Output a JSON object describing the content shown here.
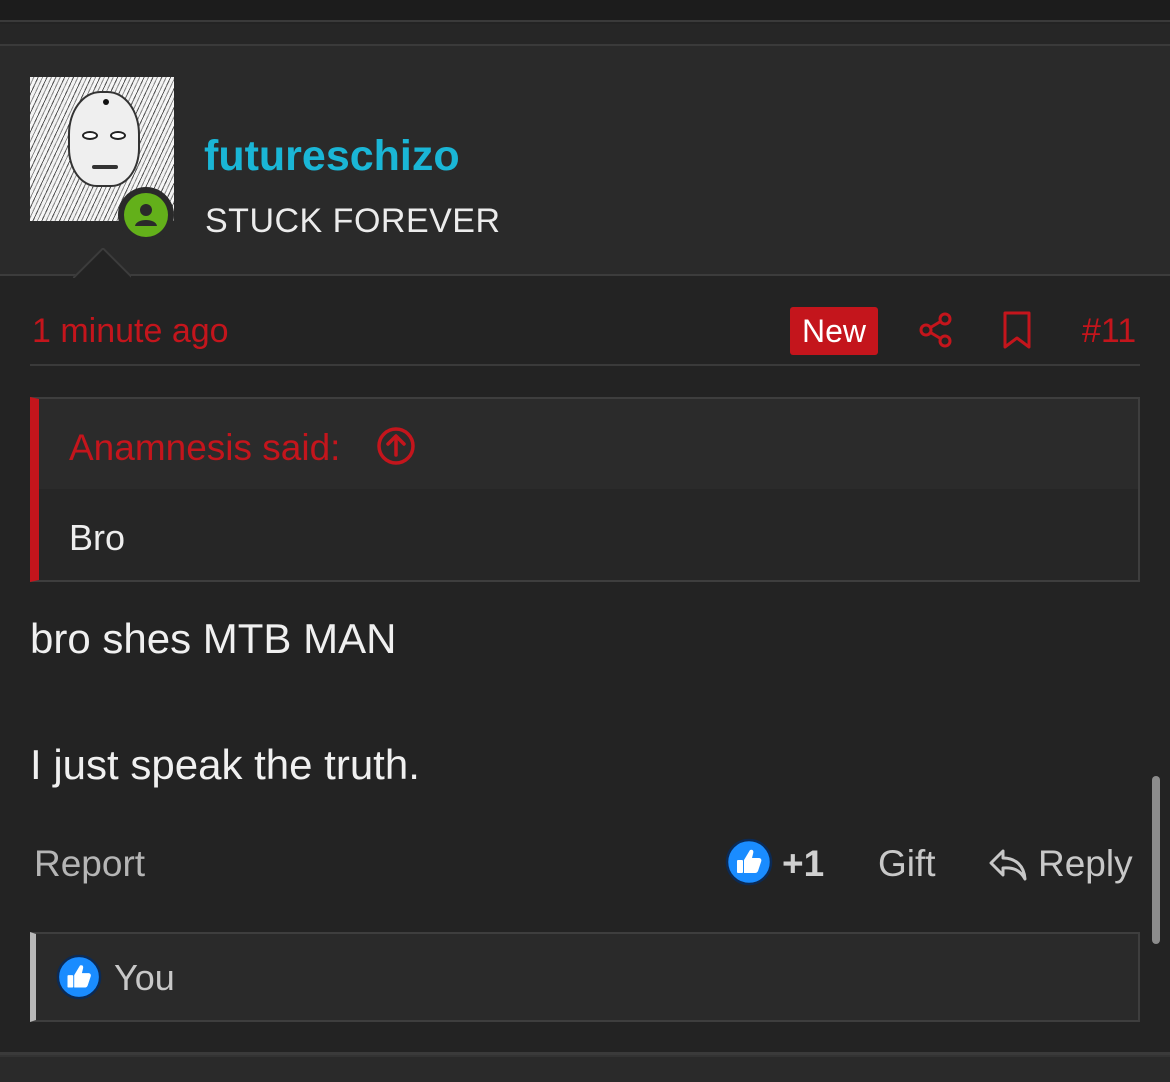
{
  "user": {
    "name": "futureschizo",
    "title": "STUCK FOREVER",
    "status": "online"
  },
  "post": {
    "time": "1 minute ago",
    "new_label": "New",
    "number": "#11"
  },
  "quote": {
    "author": "Anamnesis said:",
    "text": "Bro"
  },
  "message": {
    "lines": [
      "bro shes MTB MAN",
      "I just speak the truth."
    ]
  },
  "actions": {
    "report": "Report",
    "like_count": "+1",
    "gift": "Gift",
    "reply": "Reply"
  },
  "reactions": {
    "by": "You"
  },
  "colors": {
    "accent_red": "#c4151c",
    "username_cyan": "#1ab6d6",
    "online_green": "#63b01a",
    "like_blue": "#1a8cff"
  },
  "icons": [
    "avatar-image",
    "online-status-icon",
    "share-icon",
    "bookmark-icon",
    "arrow-up-circle-icon",
    "like-icon",
    "reply-icon"
  ]
}
